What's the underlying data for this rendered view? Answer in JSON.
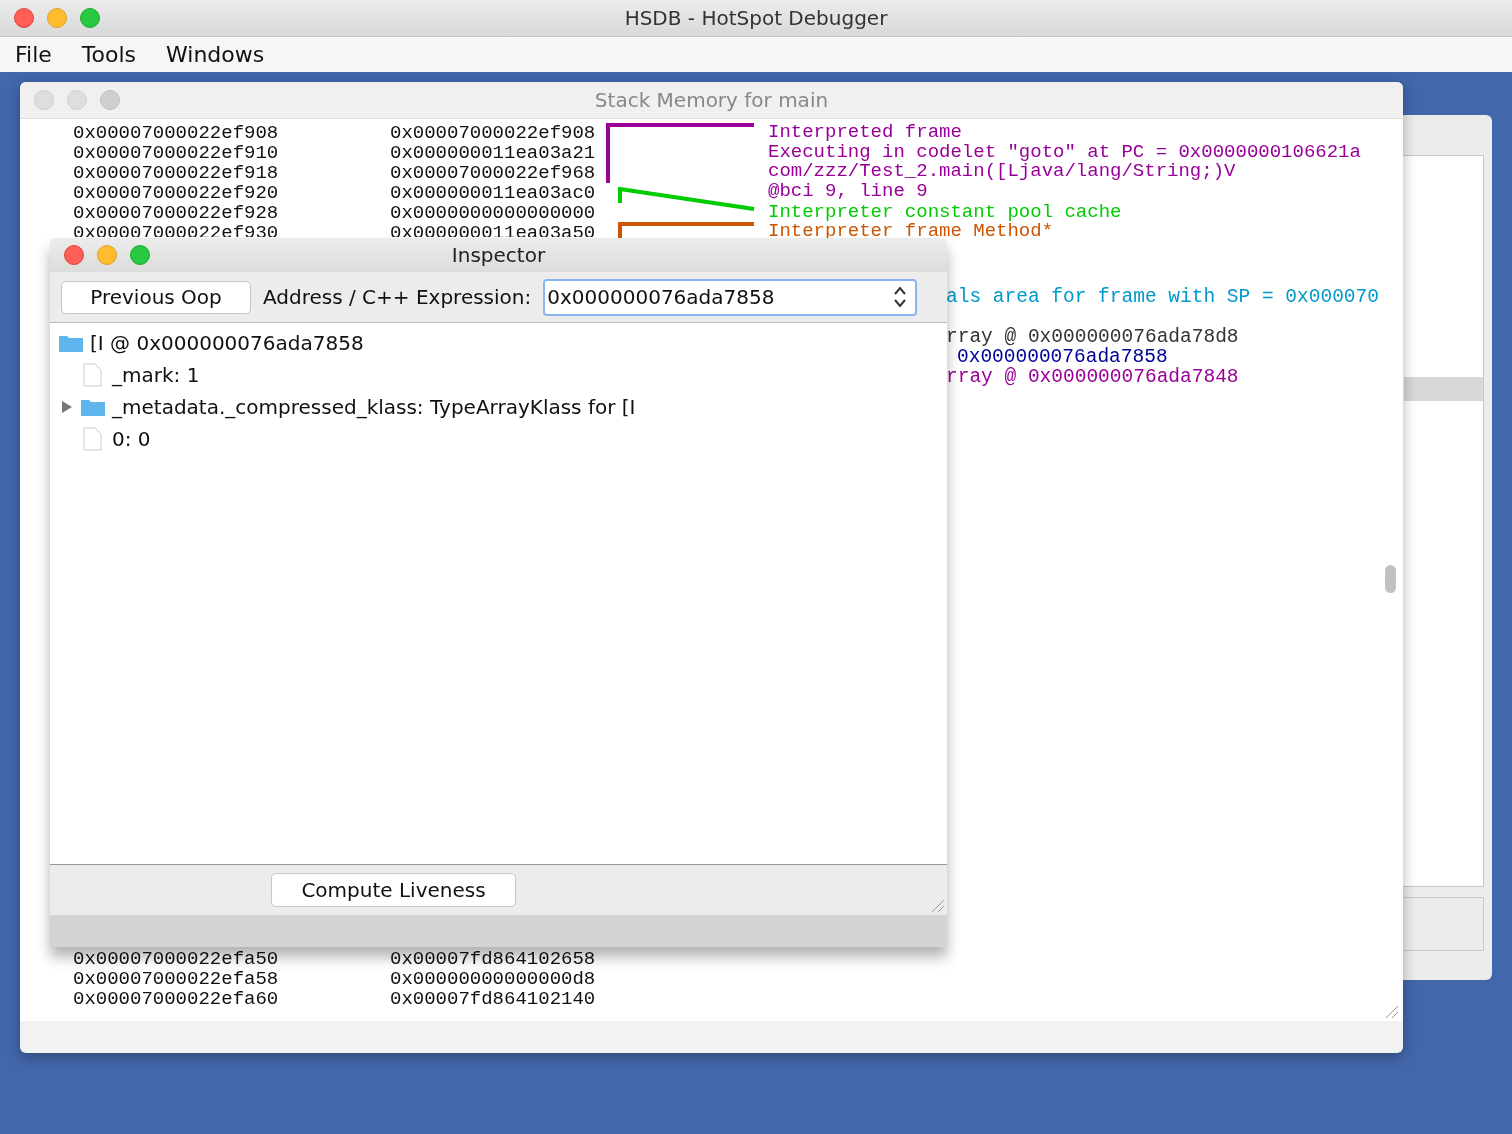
{
  "app": {
    "title": "HSDB - HotSpot Debugger",
    "menu": [
      "File",
      "Tools",
      "Windows"
    ]
  },
  "stack_window": {
    "title": "Stack Memory for main",
    "top_rows": [
      {
        "address": "0x00007000022ef908",
        "value": "0x00007000022ef908"
      },
      {
        "address": "0x00007000022ef910",
        "value": "0x000000011ea03a21"
      },
      {
        "address": "0x00007000022ef918",
        "value": "0x00007000022ef968"
      },
      {
        "address": "0x00007000022ef920",
        "value": "0x000000011ea03ac0"
      },
      {
        "address": "0x00007000022ef928",
        "value": "0x0000000000000000"
      },
      {
        "address": "0x00007000022ef930",
        "value": "0x000000011ea03a50"
      }
    ],
    "annotations": [
      {
        "kind": "bracket",
        "color": "#990099",
        "lines": [
          "Interpreted frame",
          "Executing in codelet \"goto\" at PC = 0x0000000106621a",
          "com/zzz/Test_2.main([Ljava/lang/String;)V",
          "@bci 9, line 9"
        ]
      },
      {
        "kind": "slant",
        "color": "#00cc00",
        "lines": [
          "Interpreter constant pool cache"
        ]
      },
      {
        "kind": "bracket",
        "color": "#cc5500",
        "lines": [
          "Interpreter frame Method*"
        ]
      }
    ],
    "side_notes": [
      {
        "text": "als area for frame with SP = 0x000070",
        "color": "#0099cc"
      },
      {
        "text": "rray @ 0x000000076ada78d8",
        "color": "#333333"
      },
      {
        "text": "0x000000076ada7858",
        "color": "#000099"
      },
      {
        "text": "rray @ 0x000000076ada7848",
        "color": "#990099"
      }
    ],
    "bottom_rows": [
      {
        "address": "0x00007000022efa50",
        "value": "0x00007fd864102658"
      },
      {
        "address": "0x00007000022efa58",
        "value": "0x00000000000000d8"
      },
      {
        "address": "0x00007000022efa60",
        "value": "0x00007fd864102140"
      }
    ]
  },
  "inspector": {
    "title": "Inspector",
    "previous_button": "Previous Oop",
    "address_label": "Address / C++ Expression:",
    "address_value": "0x000000076ada7858",
    "tree": [
      {
        "label": "[I @ 0x000000076ada7858",
        "kind": "folder",
        "children": [
          {
            "label": "_mark: 1",
            "kind": "leaf"
          },
          {
            "label": "_metadata._compressed_klass: TypeArrayKlass for [I",
            "kind": "folder",
            "expanded": false
          },
          {
            "label": "0: 0",
            "kind": "leaf"
          }
        ]
      }
    ],
    "compute_button": "Compute Liveness"
  }
}
